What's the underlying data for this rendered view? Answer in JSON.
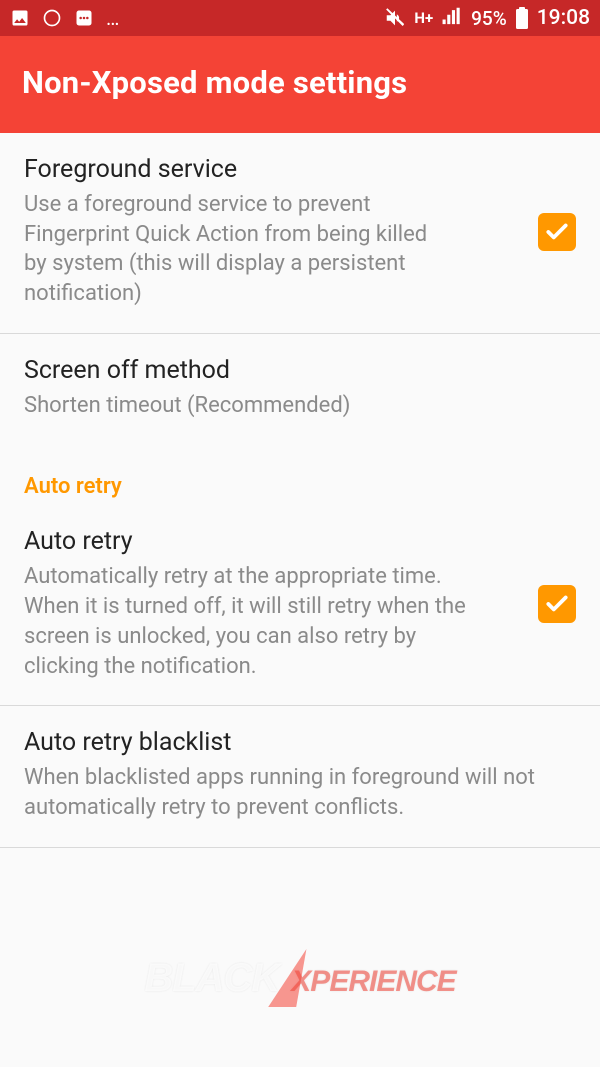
{
  "statusbar": {
    "network_indicator": "H+",
    "battery_pct": "95%",
    "time": "19:08"
  },
  "header": {
    "title": "Non-Xposed mode settings"
  },
  "settings": {
    "foreground": {
      "title": "Foreground service",
      "sub": "Use a foreground service to prevent Fingerprint Quick Action from being killed by system (this will display a persistent notification)",
      "checked": true
    },
    "screen_off": {
      "title": "Screen off method",
      "sub": "Shorten timeout (Recommended)"
    },
    "section_auto_retry": "Auto retry",
    "auto_retry": {
      "title": "Auto retry",
      "sub": "Automatically retry at the appropriate time. When it is turned off, it will still retry when the screen is unlocked, you can also retry by clicking the notification.",
      "checked": true
    },
    "blacklist": {
      "title": "Auto retry blacklist",
      "sub": "When blacklisted apps running in foreground will not automatically retry to prevent conflicts."
    }
  },
  "watermark": {
    "part1": "BLACK",
    "part2": "XPERIENCE"
  }
}
